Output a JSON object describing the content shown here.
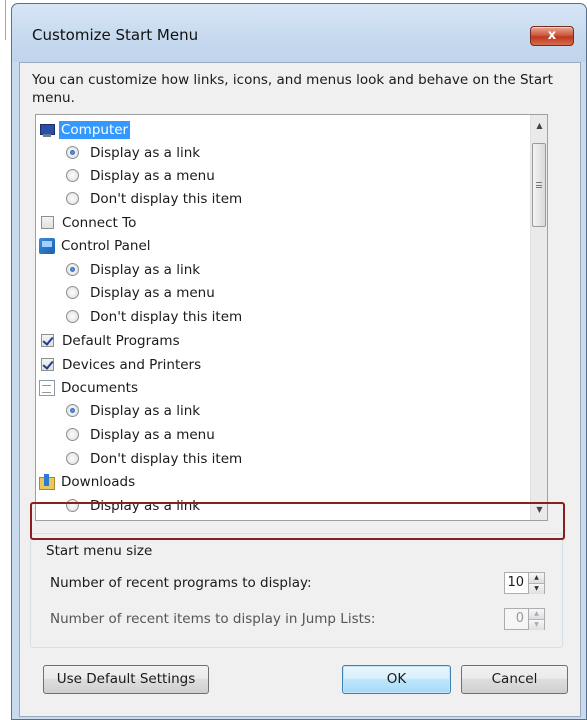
{
  "window": {
    "title": "Customize Start Menu",
    "close_label": "x"
  },
  "intro_text": "You can customize how links, icons, and menus look and behave on the Start menu.",
  "list": {
    "items": [
      {
        "label": "Computer"
      },
      {
        "label": "Display as a link"
      },
      {
        "label": "Display as a menu"
      },
      {
        "label": "Don't display this item"
      },
      {
        "label": "Connect To"
      },
      {
        "label": "Control Panel"
      },
      {
        "label": "Display as a link"
      },
      {
        "label": "Display as a menu"
      },
      {
        "label": "Don't display this item"
      },
      {
        "label": "Default Programs"
      },
      {
        "label": "Devices and Printers"
      },
      {
        "label": "Documents"
      },
      {
        "label": "Display as a link"
      },
      {
        "label": "Display as a menu"
      },
      {
        "label": "Don't display this item"
      },
      {
        "label": "Downloads"
      },
      {
        "label": "Display as a link"
      }
    ]
  },
  "start_menu_size": {
    "group_title": "Start menu size",
    "recent_programs_label": "Number of recent programs to display:",
    "recent_programs_value": "10",
    "jump_list_label": "Number of recent items to display in Jump Lists:",
    "jump_list_value": "0"
  },
  "buttons": {
    "use_default": "Use Default Settings",
    "ok": "OK",
    "cancel": "Cancel"
  },
  "icons": {
    "scroll_up": "▲",
    "scroll_down": "▼",
    "spin_up": "▲",
    "spin_down": "▼"
  }
}
